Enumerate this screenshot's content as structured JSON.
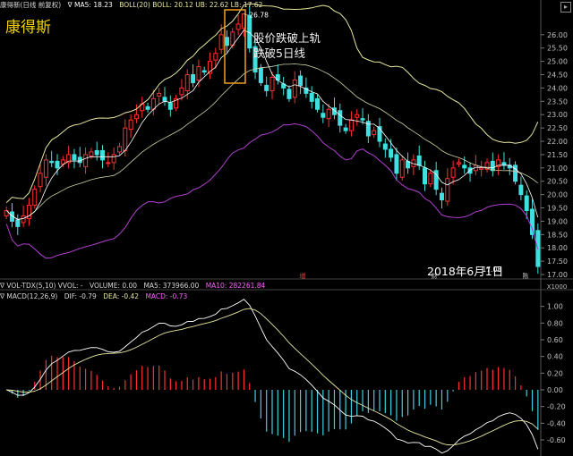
{
  "stock_name": "康得斯",
  "main_header": {
    "title": "康得新(日线 前复权)",
    "ma": "∇ MA5: 18.23",
    "boll": "BOLL(20)  BOLL: 20.12  UB: 22.62  LB: 17.62"
  },
  "annotation": {
    "line1": "股价跌破上轨",
    "line2": "跌破5日线"
  },
  "date_label": "2018年6月1日",
  "low_label": "17.08",
  "high_label": "26.78",
  "vol_header": {
    "name": "∇ VOL-TDX(5,10)  VVOL: -",
    "volume": "VOLUME: 0.00",
    "ma5": "MA5: 373966.00",
    "ma10": "MA10: 282261.84"
  },
  "macd_header": {
    "name": "∇ MACD(12,26,9)",
    "dif": "DIF: -0.79",
    "dea": "DEA: -0.42",
    "macd": "MACD: -0.73"
  },
  "marker_increase": "增",
  "marker_bottom_1": "财",
  "marker_bottom_2": "陈",
  "vol_axis_label": "X1000",
  "price_axis": [
    "26.00",
    "25.50",
    "25.00",
    "24.50",
    "24.00",
    "23.50",
    "23.00",
    "22.50",
    "22.00",
    "21.50",
    "21.00",
    "20.50",
    "20.00",
    "19.50",
    "19.00",
    "18.50",
    "18.00",
    "17.50",
    "17.00"
  ],
  "macd_axis": [
    "1.00",
    "0.80",
    "0.60",
    "0.40",
    "0.20",
    "0.00",
    "-0.20",
    "-0.40",
    "-0.60"
  ],
  "chart_data": {
    "type": "candlestick",
    "closes": [
      19.4,
      19.0,
      18.8,
      19.2,
      19.6,
      20.2,
      20.8,
      21.3,
      21.2,
      21.0,
      21.3,
      21.5,
      21.3,
      21.2,
      21.5,
      21.6,
      21.5,
      21.3,
      21.2,
      21.5,
      21.8,
      22.5,
      22.8,
      23.0,
      23.4,
      23.2,
      23.6,
      23.8,
      23.5,
      23.2,
      23.6,
      24.0,
      24.5,
      24.2,
      24.8,
      24.6,
      25.0,
      25.3,
      26.0,
      25.6,
      26.1,
      26.4,
      26.78,
      25.5,
      24.6,
      24.2,
      23.9,
      24.4,
      24.3,
      24.0,
      23.6,
      24.3,
      24.1,
      23.8,
      23.5,
      23.2,
      22.9,
      23.2,
      23.0,
      22.6,
      22.4,
      22.8,
      23.0,
      22.8,
      22.2,
      22.4,
      22.0,
      21.7,
      21.4,
      20.8,
      21.3,
      21.0,
      21.3,
      21.1,
      20.4,
      20.8,
      20.2,
      19.8,
      20.6,
      21.0,
      21.2,
      21.0,
      20.8,
      21.1,
      21.0,
      21.2,
      20.9,
      21.3,
      21.1,
      21.0,
      20.5,
      20.0,
      19.4,
      18.5,
      17.3
    ],
    "ma5_color": "#ffffff",
    "boll_upper_color": "#e8e8a0",
    "boll_lower_color": "#b040d0",
    "up_color": "#ff3030",
    "down_color": "#40e0e0"
  }
}
